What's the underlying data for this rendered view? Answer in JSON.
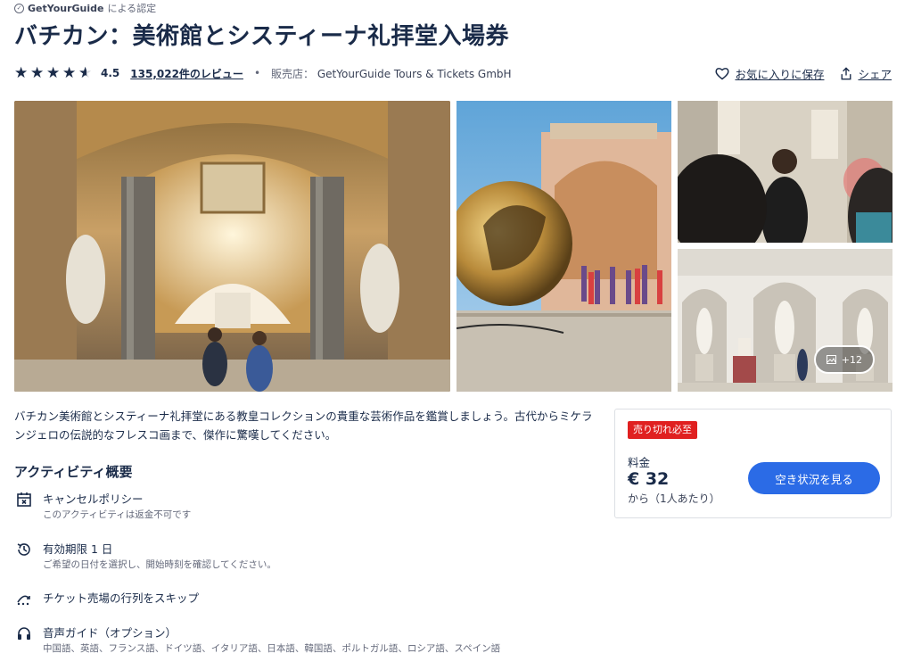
{
  "badge": {
    "brand": "GetYourGuide",
    "suffix": "による認定",
    "icon": "verified-check-icon"
  },
  "title": "バチカン：美術館とシスティーナ礼拝堂入場券",
  "rating": {
    "value": "4.5",
    "stars_filled": 4.5,
    "reviews_label": "135,022件のレビュー"
  },
  "seller": {
    "label": "販売店：",
    "name": "GetYourGuide Tours & Tickets GmbH"
  },
  "actions": {
    "favorite": "お気に入りに保存",
    "share": "シェア"
  },
  "gallery": {
    "more_label": "+12"
  },
  "description": "バチカン美術館とシスティーナ礼拝堂にある教皇コレクションの貴重な芸術作品を鑑賞しましょう。古代からミケランジェロの伝説的なフレスコ画まで、傑作に驚嘆してください。",
  "overview": {
    "title": "アクティビティ概要",
    "features": [
      {
        "icon": "calendar-cancel-icon",
        "title": "キャンセルポリシー",
        "subtitle": "このアクティビティは返金不可です"
      },
      {
        "icon": "clock-validity-icon",
        "title": "有効期限 1 日",
        "subtitle": "ご希望の日付を選択し、開始時刻を確認してください。"
      },
      {
        "icon": "skip-line-icon",
        "title": "チケット売場の行列をスキップ",
        "subtitle": ""
      },
      {
        "icon": "headphones-icon",
        "title": "音声ガイド（オプション）",
        "subtitle": "中国語、英語、フランス語、ドイツ語、イタリア語、日本語、韓国語、ポルトガル語、ロシア語、スペイン語"
      }
    ]
  },
  "price_card": {
    "badge": "売り切れ必至",
    "label": "料金",
    "value": "€ 32",
    "note": "から（1人あたり）",
    "cta": "空き状況を見る"
  },
  "colors": {
    "text": "#1a2b49",
    "cta": "#2b6be6",
    "badge": "#e02020"
  }
}
